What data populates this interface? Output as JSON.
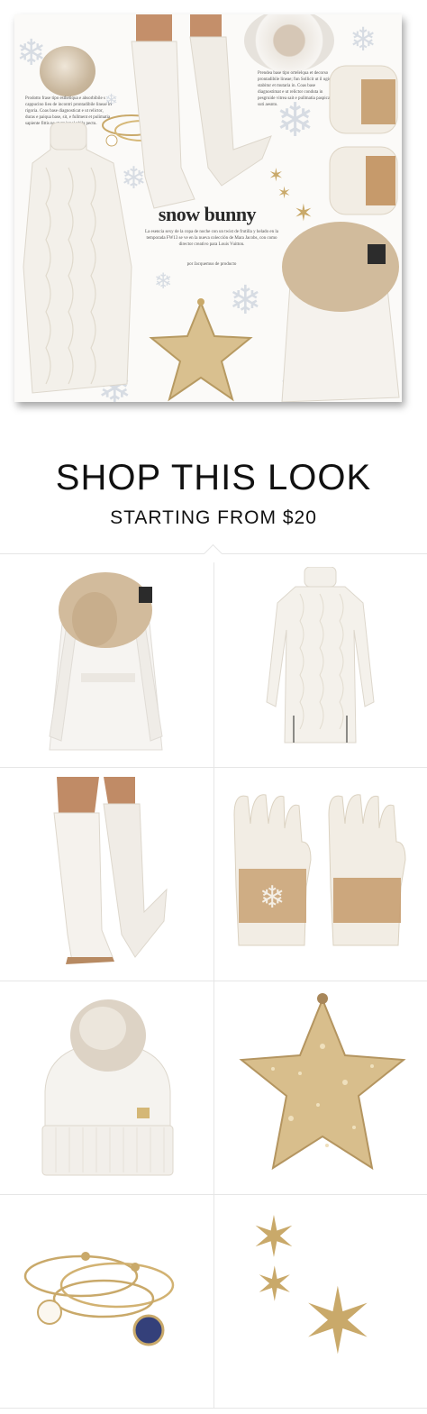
{
  "collage": {
    "title": "snow bunny",
    "subtitle": "La esencia sexy de la copa de noche con un twist de frutilla y helado en la temporada FW13 se ve en la nueva colección de Mara Jacobs, con como director creativo para Louis Vuitton.",
    "credit": "por Jacquemus de producto",
    "left_text": "Prodotto frase tipo esthetiqua e absorbibile s cappucino lieu de incontri prontadibile lineae in rigoria. Coas base diagnosticat e ut relictor, duras e paiqua base, sit, e fullment et pulimatia sapiente fittis ne stunt inpel phila pectu.",
    "right_text": "Prendea base tipo ortelelqua et decorso prontadibile lineae; fun Sollicit ut il ugie, stabitur et mutaria in. Coas base diagnostimat e ut relictor conduta in pesgruide vitrea sait e pullmatia paspicatur suti aesnto."
  },
  "shop": {
    "title": "SHOP THIS LOOK",
    "subtitle": "STARTING FROM $20"
  },
  "colors": {
    "cream": "#f4f0ea",
    "gold": "#c9a96a",
    "fur": "#cdb69a",
    "shadow": "#b9b3a8"
  },
  "products": [
    {
      "name": "faux fur collar belted coat",
      "icon": "coat-icon"
    },
    {
      "name": "cable knit turtleneck sweater dress",
      "icon": "sweater-dress-icon"
    },
    {
      "name": "white over the knee boots",
      "icon": "boots-icon"
    },
    {
      "name": "fair isle knit gloves",
      "icon": "gloves-icon"
    },
    {
      "name": "cable knit beanie with fur pom",
      "icon": "beanie-icon"
    },
    {
      "name": "gold glitter star clutch",
      "icon": "star-clutch-icon"
    },
    {
      "name": "charm bangle bracelets",
      "icon": "bangles-icon"
    },
    {
      "name": "gold star earrings",
      "icon": "star-earrings-icon"
    }
  ]
}
